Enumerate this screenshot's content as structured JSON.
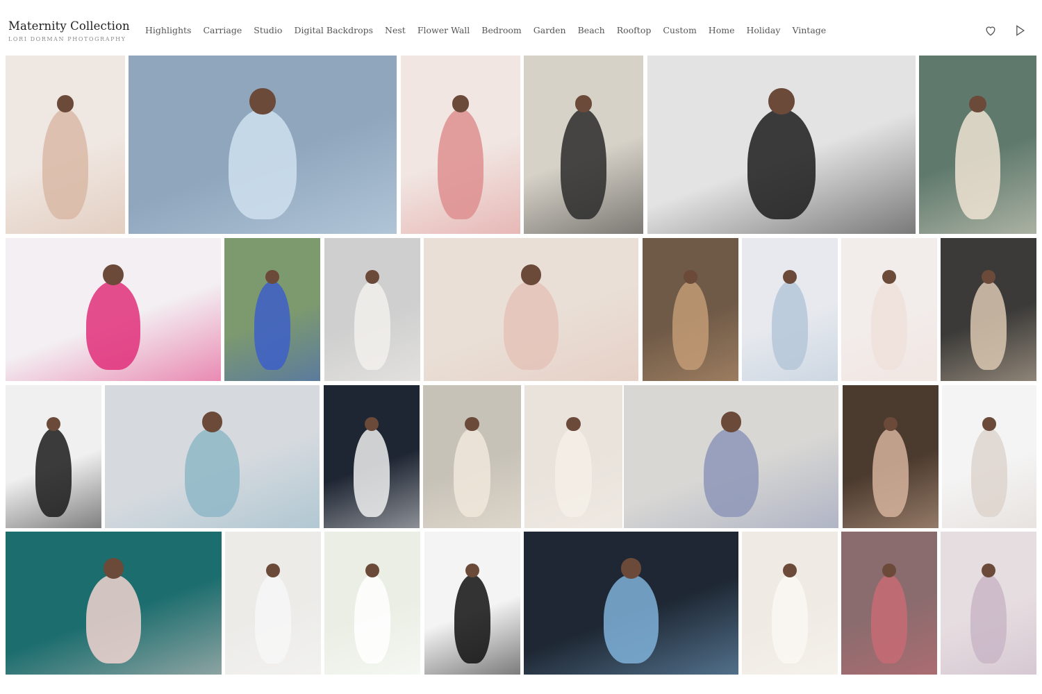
{
  "brand": {
    "title": "Maternity Collection",
    "subtitle": "LORI DORMAN PHOTOGRAPHY"
  },
  "nav": {
    "items": [
      {
        "label": "Highlights"
      },
      {
        "label": "Carriage"
      },
      {
        "label": "Studio"
      },
      {
        "label": "Digital Backdrops"
      },
      {
        "label": "Nest"
      },
      {
        "label": "Flower Wall"
      },
      {
        "label": "Bedroom"
      },
      {
        "label": "Garden"
      },
      {
        "label": "Beach"
      },
      {
        "label": "Rooftop"
      },
      {
        "label": "Custom"
      },
      {
        "label": "Home"
      },
      {
        "label": "Holiday"
      },
      {
        "label": "Vintage"
      }
    ]
  },
  "header_icons": [
    {
      "name": "heart-icon"
    },
    {
      "name": "play-icon"
    }
  ],
  "gallery": {
    "photos": [
      {
        "bg": "#efe7e1",
        "accent": "#d9b9a6"
      },
      {
        "bg": "#8fa6bd",
        "accent": "#cfe0ee"
      },
      {
        "bg": "#f1e6e2",
        "accent": "#de8f8f"
      },
      {
        "bg": "#d7d2c8",
        "accent": "#2b2b2b"
      },
      {
        "bg": "#e3e3e3",
        "accent": "#1c1c1c"
      },
      {
        "bg": "#5f7a6d",
        "accent": "#efe3d3"
      },
      {
        "bg": "#f3eff2",
        "accent": "#e0307a"
      },
      {
        "bg": "#7d9a6e",
        "accent": "#3d5fc8"
      },
      {
        "bg": "#cfcfcf",
        "accent": "#f2f0ec"
      },
      {
        "bg": "#e9dfd6",
        "accent": "#e4c3b9"
      },
      {
        "bg": "#6f5a47",
        "accent": "#c39b76"
      },
      {
        "bg": "#e7e9ee",
        "accent": "#b5c7d8"
      },
      {
        "bg": "#f2ecea",
        "accent": "#f0e2dc"
      },
      {
        "bg": "#3b3a38",
        "accent": "#d9c7b0"
      },
      {
        "bg": "#f0f0f0",
        "accent": "#1b1b1b"
      },
      {
        "bg": "#d6dadf",
        "accent": "#8fb7c7"
      },
      {
        "bg": "#1f2633",
        "accent": "#eeeeee"
      },
      {
        "bg": "#c7c2b8",
        "accent": "#f1e8dc"
      },
      {
        "bg": "#e9e3dc",
        "accent": "#f4eee8"
      },
      {
        "bg": "#d8d7d4",
        "accent": "#8d97b8"
      },
      {
        "bg": "#4b3a2e",
        "accent": "#d5b39b"
      },
      {
        "bg": "#f4f4f4",
        "accent": "#ddd3cd"
      },
      {
        "bg": "#1c6d6e",
        "accent": "#f1d4d0"
      },
      {
        "bg": "#ecebe8",
        "accent": "#f7f7f7"
      },
      {
        "bg": "#eaeee4",
        "accent": "#ffffff"
      },
      {
        "bg": "#f4f4f4",
        "accent": "#111111"
      },
      {
        "bg": "#1e2733",
        "accent": "#7fb1d9"
      },
      {
        "bg": "#efeae3",
        "accent": "#faf7f2"
      },
      {
        "bg": "#8b6c6e",
        "accent": "#c76b74"
      },
      {
        "bg": "#e6dde0",
        "accent": "#c9b6c7"
      }
    ]
  }
}
